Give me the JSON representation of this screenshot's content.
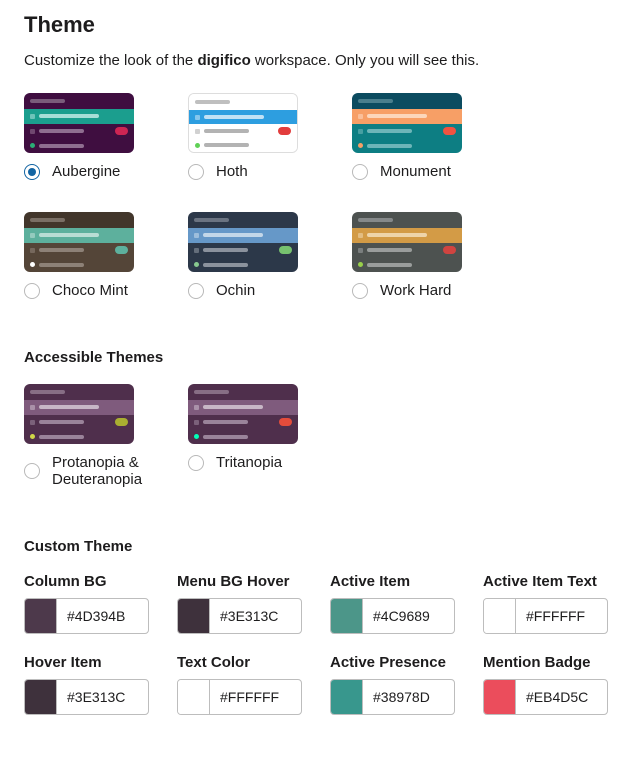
{
  "header": {
    "title": "Theme",
    "subtitle_pre": "Customize the look of the ",
    "subtitle_bold": "digifico",
    "subtitle_post": " workspace. Only you will see this."
  },
  "themes": [
    {
      "id": "aubergine",
      "label": "Aubergine",
      "selected": true,
      "header_bg": "#3F0E40",
      "header_line": "#7a5c7b",
      "row1_bg": "#1B9E8E",
      "row1_line": "#a7ded7",
      "row1_badge": null,
      "row2_bg": "#3F0E40",
      "row2_line": "#8f6e90",
      "row2_badge": "#CD2553",
      "row3_bg": "#3F0E40",
      "row3_dot": "#2BAC76",
      "row3_line": "#8f6e90"
    },
    {
      "id": "hoth",
      "label": "Hoth",
      "selected": false,
      "border": true,
      "header_bg": "#FFFFFF",
      "header_line": "#bfbfbf",
      "row1_bg": "#2D9EE0",
      "row1_line": "#c0e1f5",
      "row1_badge": null,
      "row2_bg": "#FFFFFF",
      "row2_line": "#b3b3b3",
      "row2_badge": "#E23C3C",
      "row3_bg": "#FFFFFF",
      "row3_dot": "#60D156",
      "row3_line": "#b3b3b3"
    },
    {
      "id": "monument",
      "label": "Monument",
      "selected": false,
      "header_bg": "#0C4C60",
      "header_line": "#4a7f8d",
      "row1_bg": "#F79F66",
      "row1_line": "#fcd6bb",
      "row1_badge": null,
      "row2_bg": "#0D7E83",
      "row2_line": "#6db5b8",
      "row2_badge": "#F15340",
      "row3_bg": "#0D7E83",
      "row3_dot": "#F79F66",
      "row3_line": "#6db5b8"
    },
    {
      "id": "chocomint",
      "label": "Choco Mint",
      "selected": false,
      "header_bg": "#42362B",
      "header_line": "#7a6f65",
      "row1_bg": "#5DB09D",
      "row1_line": "#b9ddd4",
      "row1_badge": null,
      "row2_bg": "#544538",
      "row2_line": "#8d8177",
      "row2_badge": "#5DB09D",
      "row3_bg": "#544538",
      "row3_dot": "#FFFFFF",
      "row3_line": "#8d8177"
    },
    {
      "id": "ochin",
      "label": "Ochin",
      "selected": false,
      "header_bg": "#2C3849",
      "header_line": "#6a7381",
      "row1_bg": "#6698C8",
      "row1_line": "#c3d7e9",
      "row1_badge": null,
      "row2_bg": "#2C3849",
      "row2_line": "#8b929d",
      "row2_badge": "#77C26F",
      "row3_bg": "#2C3849",
      "row3_dot": "#88C98F",
      "row3_line": "#8b929d"
    },
    {
      "id": "workhard",
      "label": "Work Hard",
      "selected": false,
      "header_bg": "#4D5250",
      "header_line": "#85898a",
      "row1_bg": "#D39B46",
      "row1_line": "#eed4a9",
      "row1_badge": null,
      "row2_bg": "#4D5250",
      "row2_line": "#9a9d9c",
      "row2_badge": "#D04440",
      "row3_bg": "#4D5250",
      "row3_dot": "#99D04A",
      "row3_line": "#9a9d9c"
    }
  ],
  "accessible": {
    "title": "Accessible Themes",
    "themes": [
      {
        "id": "protanopia",
        "label": "Protanopia & Deuteranopia",
        "selected": false,
        "header_bg": "#4F2F4C",
        "header_line": "#876e85",
        "row1_bg": "#7F5B7D",
        "row1_line": "#c7b6c6",
        "row1_badge": null,
        "row2_bg": "#4F2F4C",
        "row2_line": "#9a839a",
        "row2_badge": "#A9AF31",
        "row3_bg": "#4F2F4C",
        "row3_dot": "#D0D848",
        "row3_line": "#9a839a"
      },
      {
        "id": "tritanopia",
        "label": "Tritanopia",
        "selected": false,
        "header_bg": "#4F2F4C",
        "header_line": "#876e85",
        "row1_bg": "#7F5B7D",
        "row1_line": "#c7b6c6",
        "row1_badge": null,
        "row2_bg": "#4F2F4C",
        "row2_line": "#9a839a",
        "row2_badge": "#E44C3B",
        "row3_bg": "#4F2F4C",
        "row3_dot": "#00FFB7",
        "row3_line": "#9a839a"
      }
    ]
  },
  "custom": {
    "title": "Custom Theme",
    "fields": [
      {
        "id": "column_bg",
        "label": "Column BG",
        "value": "#4D394B"
      },
      {
        "id": "menu_bg_hover",
        "label": "Menu BG Hover",
        "value": "#3E313C"
      },
      {
        "id": "active_item",
        "label": "Active Item",
        "value": "#4C9689"
      },
      {
        "id": "active_item_text",
        "label": "Active Item Text",
        "value": "#FFFFFF"
      },
      {
        "id": "hover_item",
        "label": "Hover Item",
        "value": "#3E313C"
      },
      {
        "id": "text_color",
        "label": "Text Color",
        "value": "#FFFFFF"
      },
      {
        "id": "active_presence",
        "label": "Active Presence",
        "value": "#38978D"
      },
      {
        "id": "mention_badge",
        "label": "Mention Badge",
        "value": "#EB4D5C"
      }
    ]
  }
}
